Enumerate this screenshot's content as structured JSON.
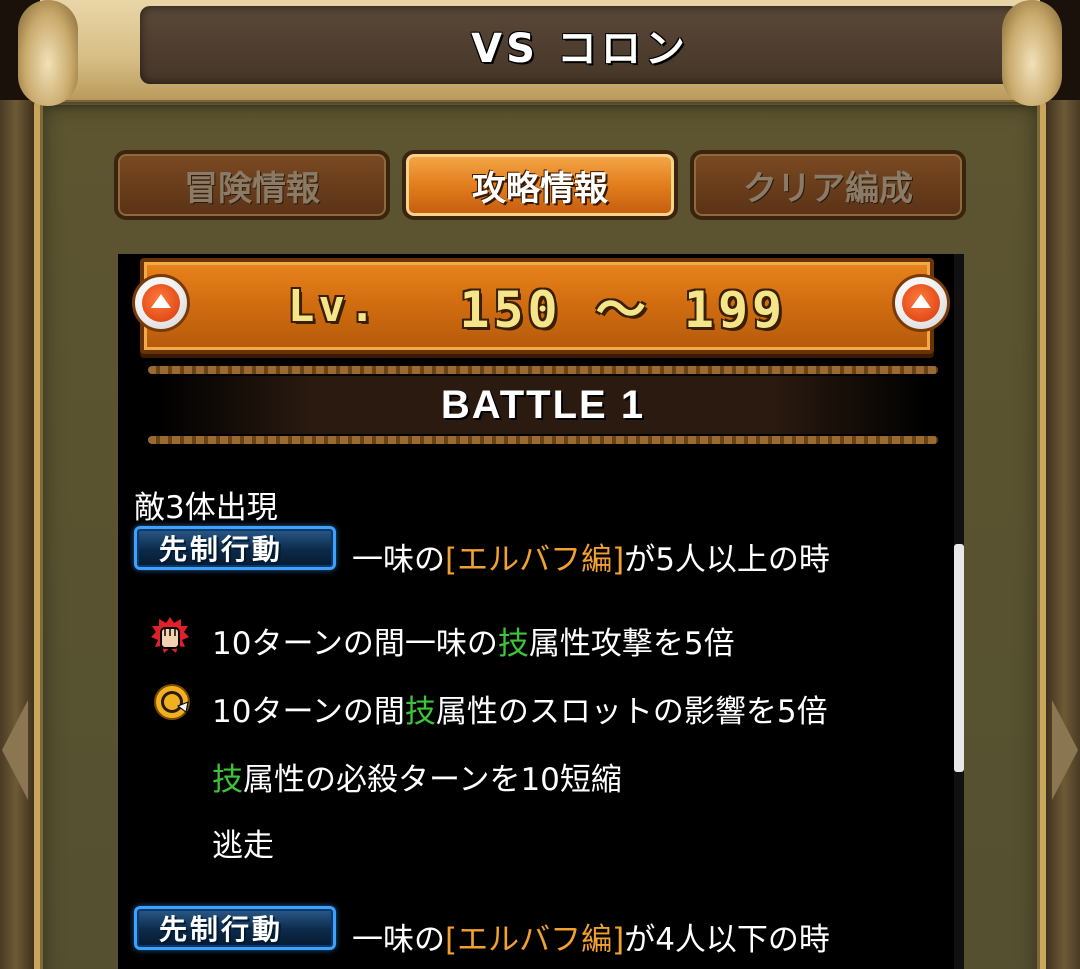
{
  "header": {
    "title": "VS コロン"
  },
  "tabs": [
    {
      "label": "冒険情報",
      "active": false
    },
    {
      "label": "攻略情報",
      "active": true
    },
    {
      "label": "クリア編成",
      "active": false
    }
  ],
  "level": {
    "prefix": "Lv.",
    "range": "150 ～ 199"
  },
  "battle": {
    "title": "BATTLE 1",
    "enemy_info": "敵3体出現",
    "preemptive_badge": "先制行動",
    "condition1": {
      "pre": "一味の",
      "tag": "[エルバフ編]",
      "post": "が5人以上の時"
    },
    "effects": [
      {
        "icon": "fist-attack-icon",
        "pre": "10ターンの間一味の",
        "hl": "技",
        "post": "属性攻撃を5倍"
      },
      {
        "icon": "slot-boost-icon",
        "pre": "10ターンの間",
        "hl": "技",
        "post": "属性のスロットの影響を5倍"
      },
      {
        "icon": "",
        "pre": "",
        "hl": "技",
        "post": "属性の必殺ターンを10短縮"
      },
      {
        "icon": "",
        "pre": "逃走",
        "hl": "",
        "post": ""
      }
    ],
    "condition2": {
      "pre": "一味の",
      "tag": "[エルバフ編]",
      "post": "が4人以下の時"
    }
  },
  "colors": {
    "highlight_green": "#3ec43a",
    "highlight_orange": "#f2a030",
    "active_tab": "#e07a1a",
    "badge_border": "#3ea0ff"
  }
}
